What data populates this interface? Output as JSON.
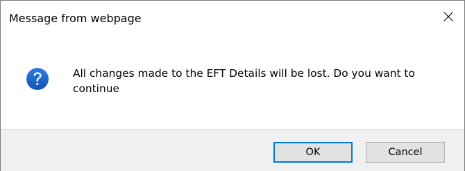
{
  "dialog": {
    "title": "Message from webpage",
    "close_icon": "close-icon",
    "icon": "question-icon",
    "icon_color": "#1f66c7",
    "message": "All changes made to the EFT Details will be lost. Do you want to continue",
    "buttons": {
      "ok_label": "OK",
      "cancel_label": "Cancel"
    },
    "focus_color": "#0078d7"
  }
}
